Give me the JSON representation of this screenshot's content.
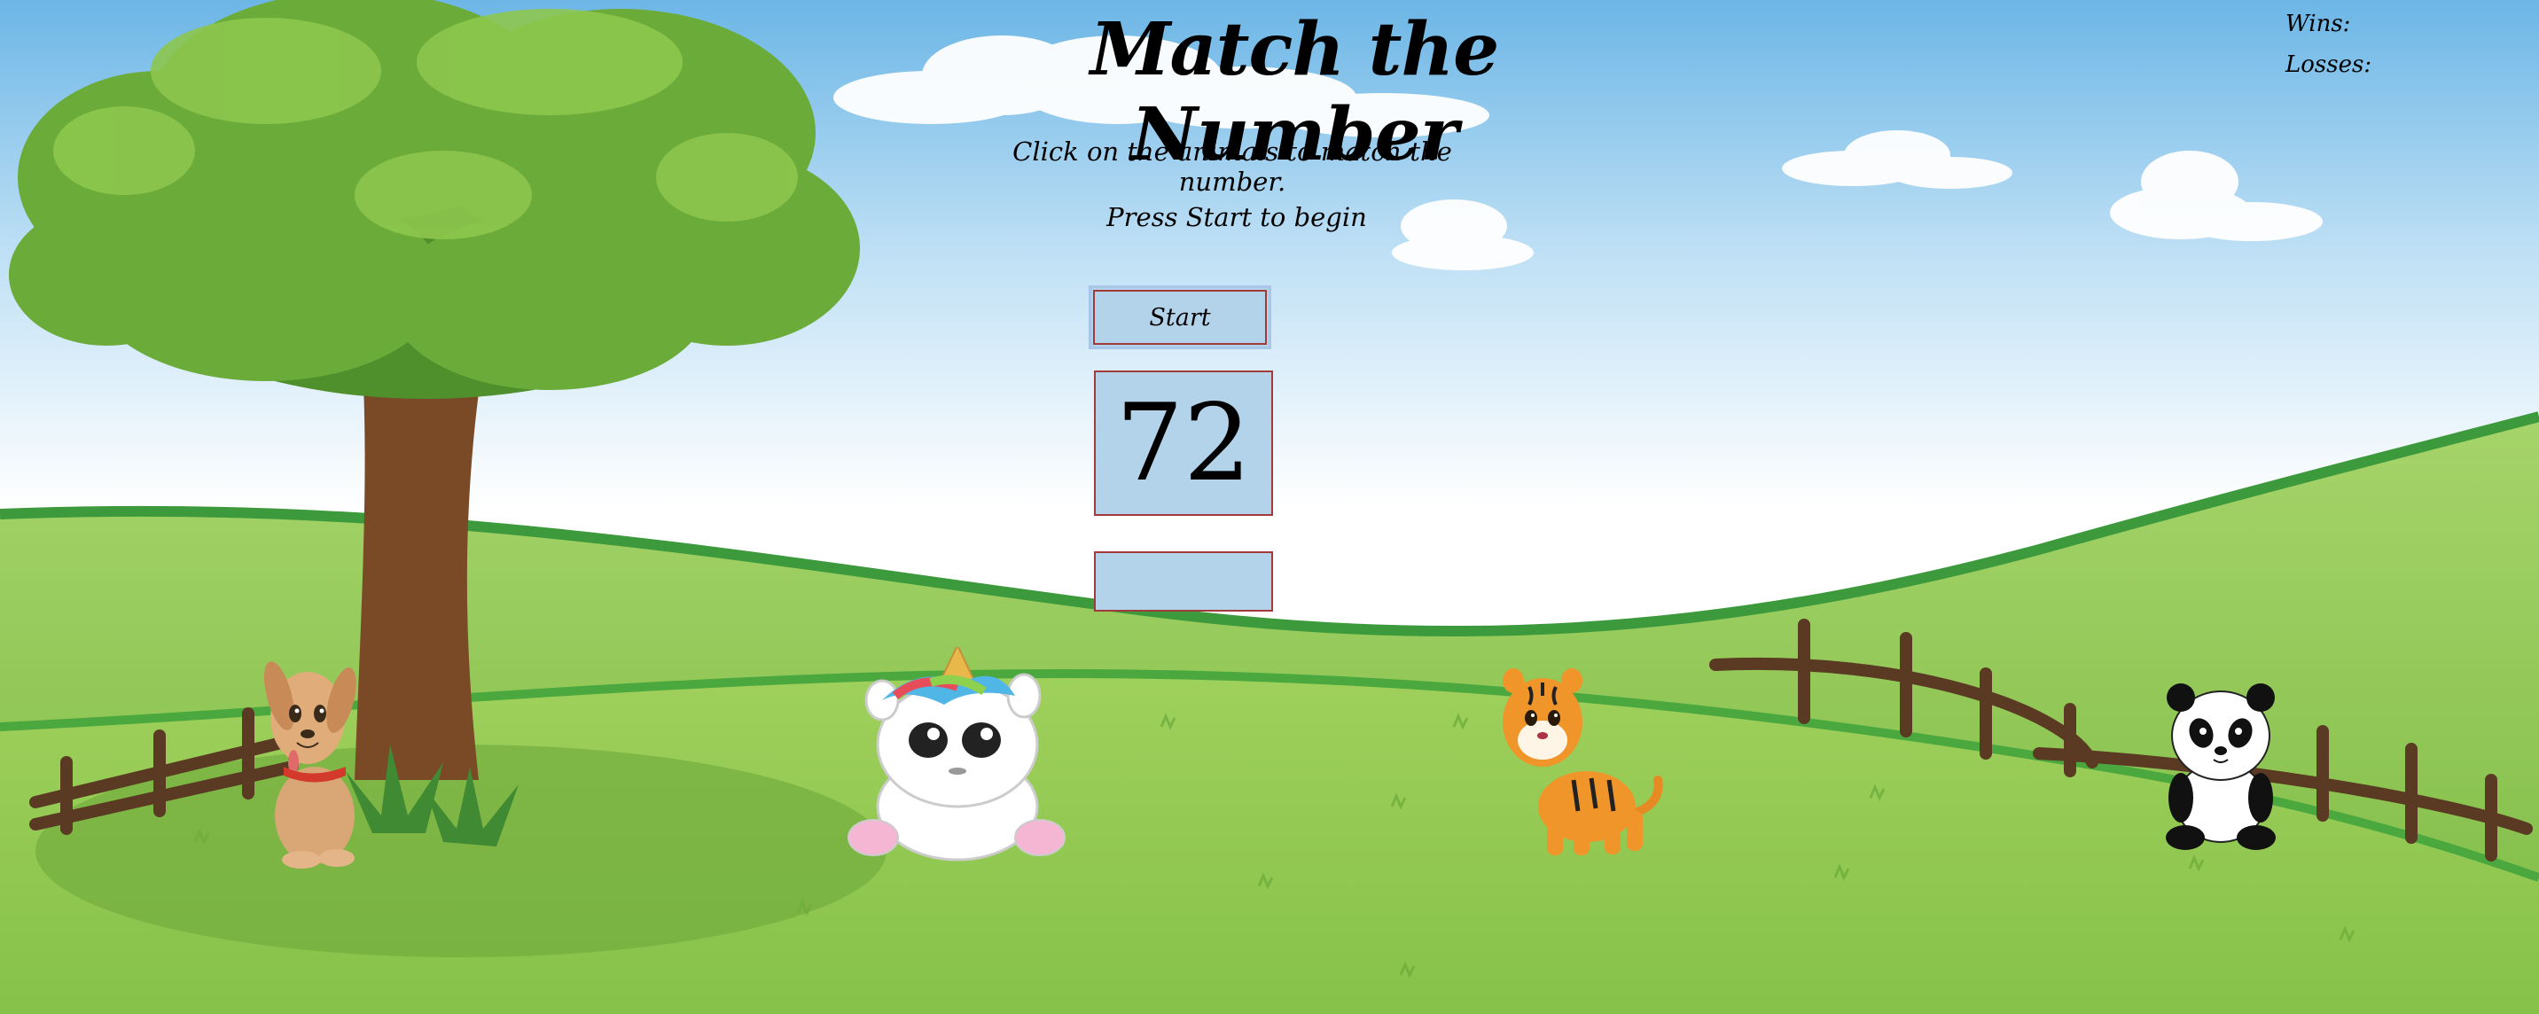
{
  "game": {
    "title": "Match the Number",
    "instructions": "Click on the animals to match the number.",
    "prompt": "Press Start to begin",
    "start_label": "Start",
    "target_number": "72",
    "user_score": ""
  },
  "scoreboard": {
    "wins_label": "Wins:",
    "losses_label": "Losses:"
  },
  "animals": [
    {
      "name": "puppy"
    },
    {
      "name": "unicorn"
    },
    {
      "name": "tiger"
    },
    {
      "name": "panda"
    }
  ],
  "colors": {
    "sky_top": "#6cb6e6",
    "sky_bottom": "#ffffff",
    "grass_light": "#9ccf5a",
    "grass_dark": "#6fae3c",
    "hill_edge": "#3d9a3c",
    "panel_fill": "#b3d3ea",
    "panel_border": "#a23a3a"
  }
}
